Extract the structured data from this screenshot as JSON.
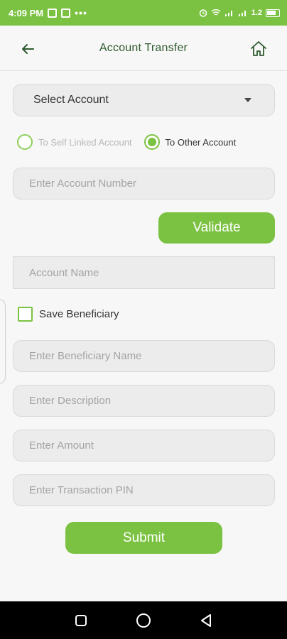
{
  "status_bar": {
    "time": "4:09 PM",
    "dots": "•••",
    "speed": "1.2"
  },
  "header": {
    "title": "Account Transfer",
    "back_icon": "arrow-left-icon",
    "home_icon": "home-icon"
  },
  "form": {
    "select_account": "Select Account",
    "radio_options": [
      {
        "label": "To Self Linked Account",
        "checked": false
      },
      {
        "label": "To Other Account",
        "checked": true
      }
    ],
    "account_number_placeholder": "Enter Account Number",
    "validate_label": "Validate",
    "account_name_placeholder": "Account Name",
    "save_beneficiary_label": "Save Beneficiary",
    "beneficiary_name_placeholder": "Enter Beneficiary Name",
    "description_placeholder": "Enter Description",
    "amount_placeholder": "Enter Amount",
    "pin_placeholder": "Enter Transaction PIN",
    "submit_label": "Submit"
  },
  "colors": {
    "accent": "#7cc242",
    "title": "#2e5a2e",
    "field_bg": "#ececec"
  }
}
